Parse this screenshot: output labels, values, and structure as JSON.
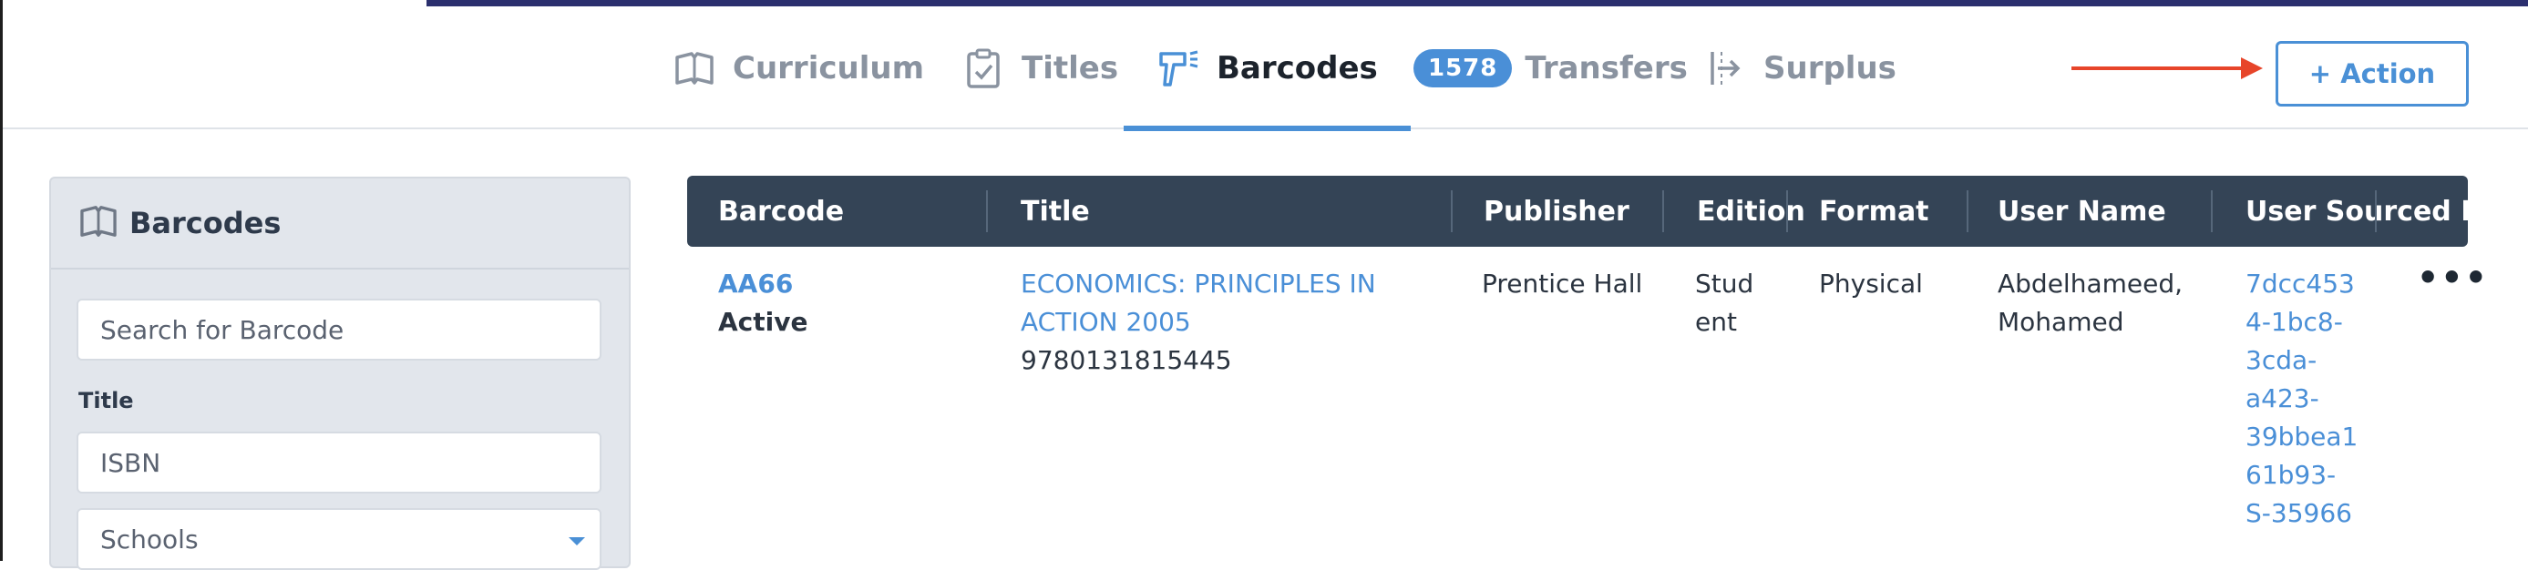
{
  "nav": {
    "tabs": [
      {
        "label": "Curriculum",
        "icon": "book-icon"
      },
      {
        "label": "Titles",
        "icon": "clipboard-check-icon"
      },
      {
        "label": "Barcodes",
        "icon": "barcode-scanner-icon"
      },
      {
        "label": "Transfers",
        "badge": "1578"
      },
      {
        "label": "Surplus",
        "icon": "surplus-arrow-icon"
      }
    ],
    "active_tab": "Barcodes",
    "action_label": "+ Action",
    "accent_color": "#4a90d6",
    "arrow_color": "#e7452a"
  },
  "sidebar": {
    "title": "Barcodes",
    "search_placeholder": "Search for Barcode",
    "title_label": "Title",
    "isbn_placeholder": "ISBN",
    "schools_label": "Schools"
  },
  "table": {
    "headers": [
      "Barcode",
      "Title",
      "Publisher",
      "Edition",
      "Format",
      "User Name",
      "User Sourced ID"
    ],
    "rows": [
      {
        "barcode": "AA66",
        "status": "Active",
        "title_line1": "ECONOMICS: PRINCIPLES IN",
        "title_line2": "ACTION 2005",
        "isbn": "9780131815445",
        "publisher": "Prentice Hall",
        "edition_line1": "Stud",
        "edition_line2": "ent",
        "format": "Physical",
        "user_name_line1": "Abdelhameed,",
        "user_name_line2": "Mohamed",
        "sourced_id_lines": [
          "7dcc453",
          "4-1bc8-",
          "3cda-",
          "a423-",
          "39bbea1",
          "61b93-",
          "S-35966"
        ]
      }
    ]
  }
}
